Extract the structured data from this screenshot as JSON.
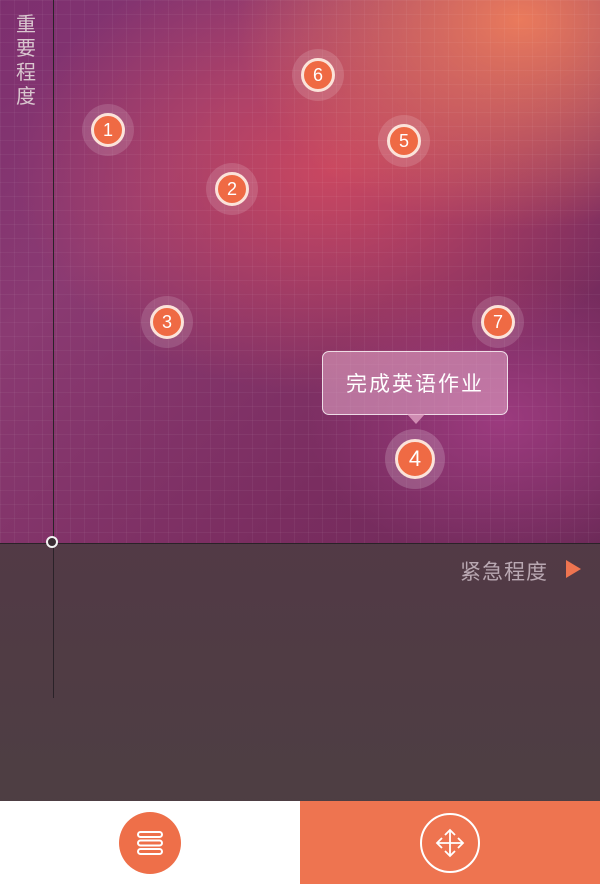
{
  "axes": {
    "y_label": "重要程度",
    "x_label": "紧急程度"
  },
  "tasks": [
    {
      "number": "1"
    },
    {
      "number": "2"
    },
    {
      "number": "3"
    },
    {
      "number": "4",
      "selected": true
    },
    {
      "number": "5"
    },
    {
      "number": "6"
    },
    {
      "number": "7"
    }
  ],
  "tooltip": {
    "text": "完成英语作业"
  },
  "tabbar": {
    "list_icon": "list-icon",
    "move_icon": "move-arrows-icon"
  },
  "colors": {
    "accent": "#ee7450",
    "marker": "#ef6a44",
    "axis": "#2a2228"
  }
}
